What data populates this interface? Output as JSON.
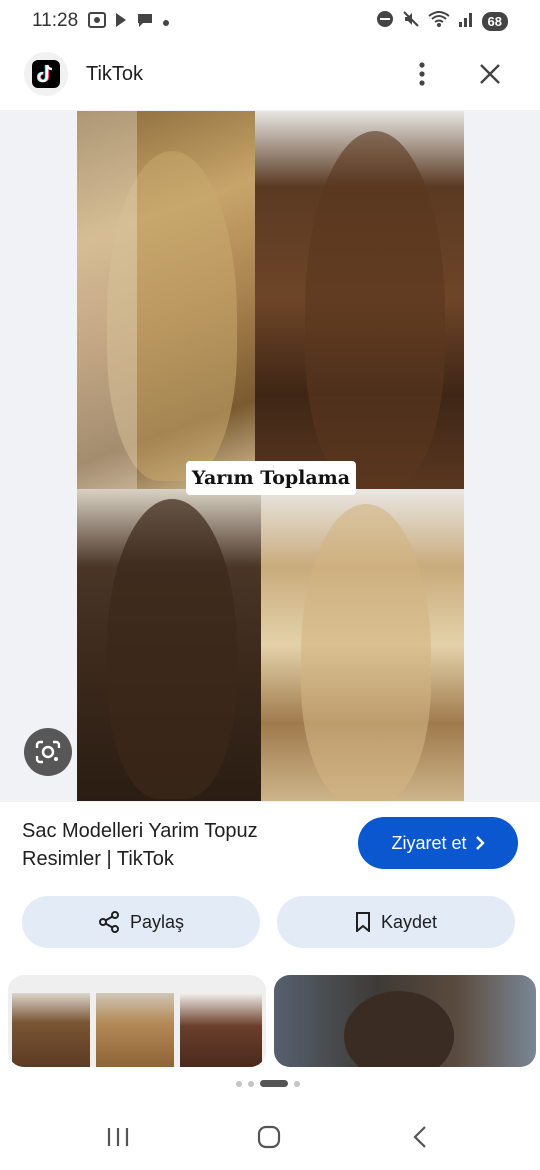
{
  "status_bar": {
    "time": "11:28",
    "battery": "68",
    "left_icons": [
      "screenshot-icon",
      "media-icon",
      "chat-icon",
      "dot-icon"
    ],
    "right_icons": [
      "dnd-icon",
      "mute-icon",
      "wifi-icon",
      "signal-icon"
    ]
  },
  "header": {
    "title": "TikTok",
    "logo_icon": "tiktok-logo-icon",
    "more_icon": "more-vert-icon",
    "close_icon": "close-icon"
  },
  "image": {
    "overlay_label": "Yarım Toplama",
    "lens_icon": "google-lens-icon"
  },
  "result": {
    "title": "Sac Modelleri Yarim Topuz Resimler | TikTok",
    "visit_label": "Ziyaret et",
    "share_label": "Paylaş",
    "save_label": "Kaydet"
  },
  "pager": {
    "count": 4,
    "active": 2
  },
  "colors": {
    "accent": "#0b57d0",
    "chip_bg": "#e3ebf7",
    "viewer_bg": "#f0f2f5"
  }
}
